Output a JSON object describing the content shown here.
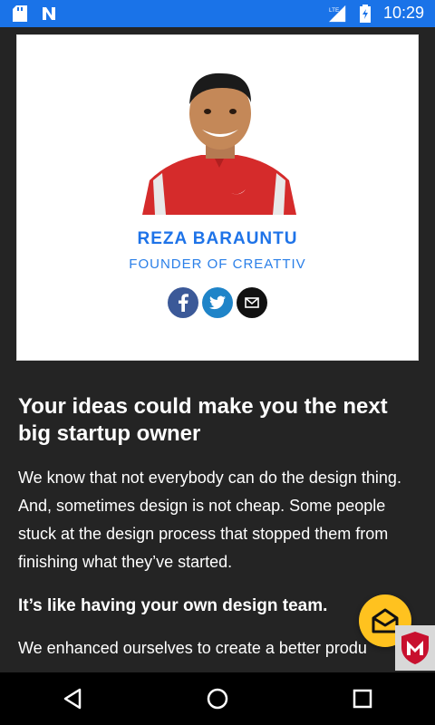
{
  "status_bar": {
    "time": "10:29",
    "network": "LTE",
    "icons": [
      "sd-card-icon",
      "n-notification-icon",
      "signal-icon",
      "battery-icon"
    ]
  },
  "profile": {
    "name": "REZA BARAUNTU",
    "role": "FOUNDER OF CREATTIV",
    "social": [
      {
        "name": "facebook-icon",
        "glyph": "f"
      },
      {
        "name": "twitter-icon",
        "glyph": "🐦"
      },
      {
        "name": "email-icon",
        "glyph": "✉"
      }
    ]
  },
  "article": {
    "headline": "Your ideas could make you the next big startup owner",
    "paragraph": "We know that not everybody can do the design thing. And, sometimes design is not cheap. Some people stuck at the design process that stopped them from finishing what they’ve started.",
    "subheading": "It’s like having your own design team.",
    "paragraph2": "We enhanced ourselves to create a better produ"
  },
  "colors": {
    "status_bar": "#1a73e8",
    "accent": "#1e73e8",
    "fab": "#ffc21f"
  }
}
